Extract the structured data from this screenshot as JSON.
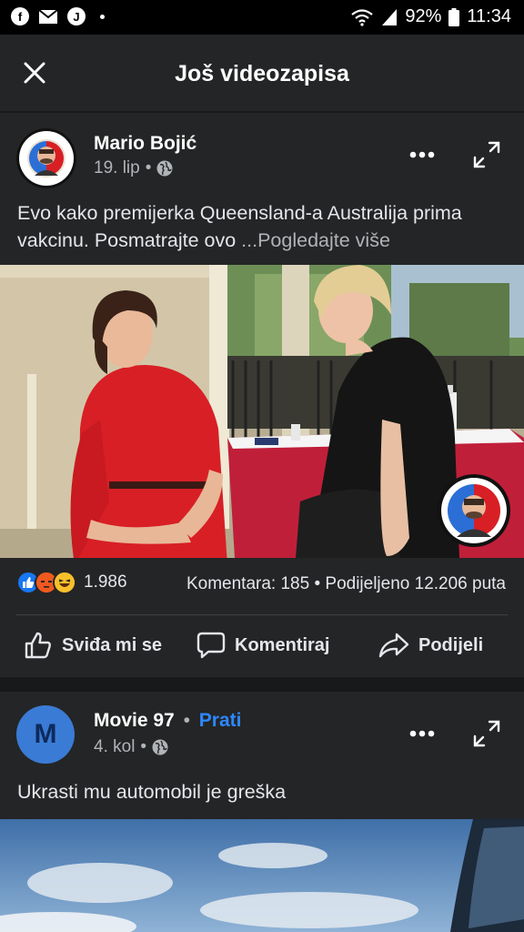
{
  "status_bar": {
    "left_icons": [
      "facebook-icon",
      "gmail-icon",
      "j-app-icon",
      "dot-icon"
    ],
    "battery_percent": "92%",
    "time": "11:34"
  },
  "header": {
    "title": "Još videozapisa",
    "close_icon": "close-icon"
  },
  "posts": [
    {
      "author": "Mario Bojić",
      "date": "19. lip",
      "audience_icon": "globe-icon",
      "text": "Evo kako premijerka Queensland-a Australija prima vakcinu. Posmatrajte ovo ",
      "see_more": "...Pogledajte više",
      "reaction_count": "1.986",
      "comments": "Komentara: 185",
      "separator": "•",
      "shares": "Podijeljeno 12.206 puta",
      "actions": {
        "like": "Sviđa mi se",
        "comment": "Komentiraj",
        "share": "Podijeli"
      }
    },
    {
      "author": "Movie 97",
      "author_initial": "M",
      "dot": "•",
      "follow": "Prati",
      "date": "4. kol",
      "audience_icon": "globe-icon",
      "text": "Ukrasti mu automobil je greška"
    }
  ],
  "colors": {
    "background": "#18191a",
    "card": "#242526",
    "accent_blue": "#2d88ff",
    "like_blue": "#1877f2",
    "red_dress": "#d81f25"
  }
}
